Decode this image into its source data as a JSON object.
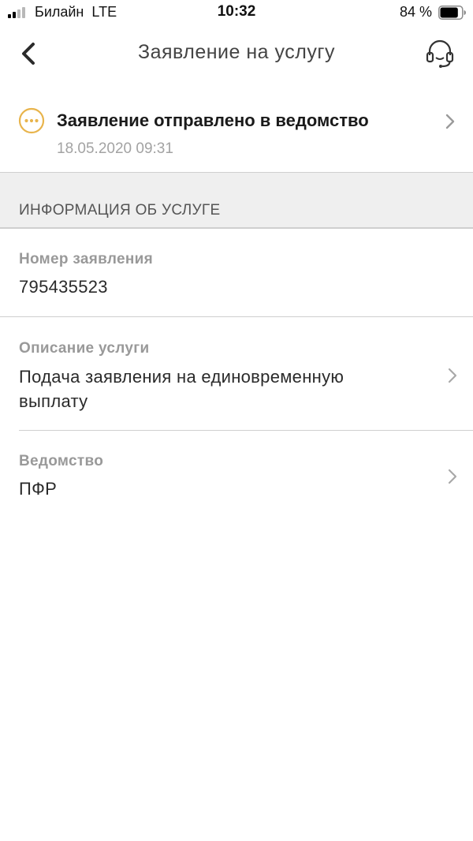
{
  "status_bar": {
    "carrier": "Билайн",
    "network": "LTE",
    "time": "10:32",
    "battery_text": "84 %",
    "battery_level": 0.84
  },
  "nav": {
    "title": "Заявление на услугу",
    "back_icon": "chevron-left-icon",
    "support_icon": "headset-icon"
  },
  "status": {
    "title": "Заявление отправлено в ведомство",
    "date": "18.05.2020 09:31",
    "icon": "pending-dots-icon",
    "accent_color": "#e8b44c"
  },
  "section": {
    "header": "ИНФОРМАЦИЯ ОБ УСЛУГЕ"
  },
  "fields": {
    "number": {
      "label": "Номер заявления",
      "value": "795435523"
    },
    "description": {
      "label": "Описание услуги",
      "value": "Подача заявления на единовременную выплату"
    },
    "department": {
      "label": "Ведомство",
      "value": "ПФР"
    }
  }
}
